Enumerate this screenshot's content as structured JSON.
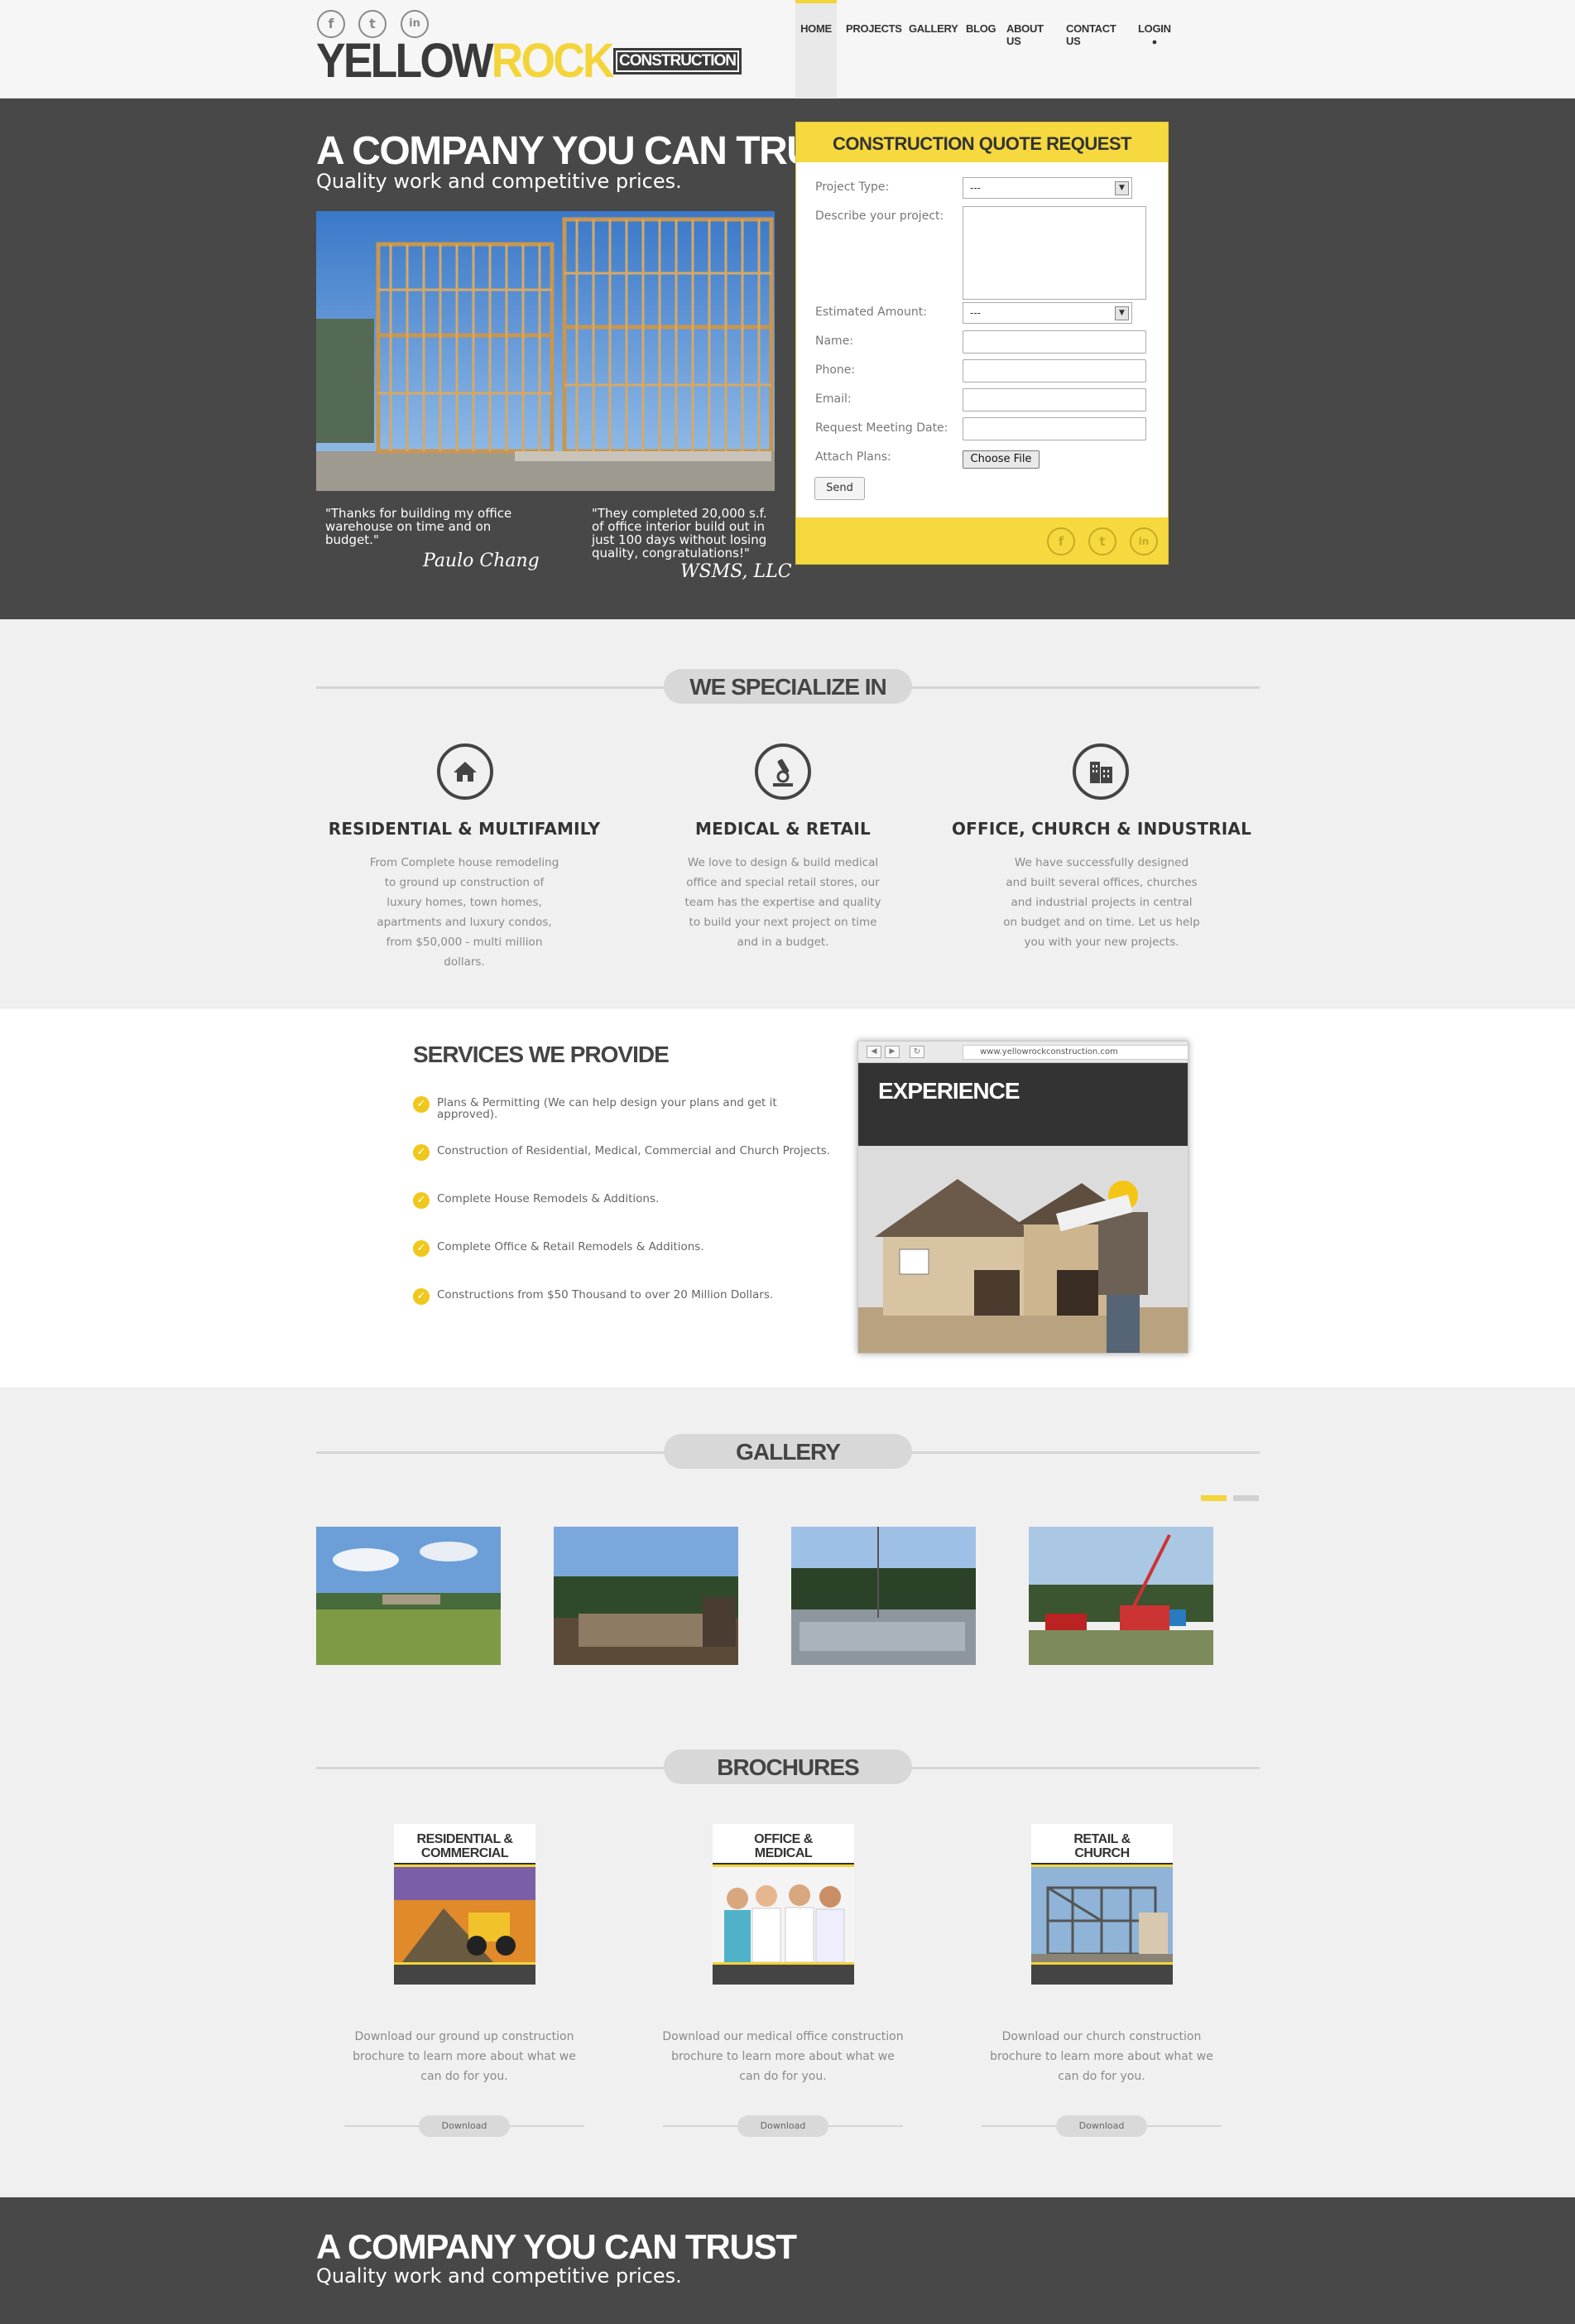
{
  "header": {
    "logo_part1": "YELLOW",
    "logo_part2": "ROCK",
    "logo_part3": "CONSTRUCTION",
    "social": [
      "f",
      "t",
      "in"
    ],
    "nav": [
      {
        "label": "HOME",
        "active": true
      },
      {
        "label": "PROJECTS"
      },
      {
        "label": "GALLERY"
      },
      {
        "label": "BLOG"
      },
      {
        "label": "ABOUT US"
      },
      {
        "label": "CONTACT US"
      },
      {
        "label": "LOGIN"
      }
    ]
  },
  "hero": {
    "title": "A COMPANY YOU CAN TRUST",
    "subtitle": "Quality work and competitive prices.",
    "quote1": "\"Thanks for building my office warehouse on time and on budget.\"",
    "quote1_author": "Paulo Chang",
    "quote2": "\"They completed 20,000 s.f. of office interior build out in just 100 days without losing quality, congratulations!\"",
    "quote2_author": "WSMS, LLC"
  },
  "quote_form": {
    "title": "CONSTRUCTION QUOTE REQUEST",
    "project_type_label": "Project Type:",
    "project_type_value": "---",
    "describe_label": "Describe your project:",
    "estimated_label": "Estimated Amount:",
    "estimated_value": "---",
    "name_label": "Name:",
    "phone_label": "Phone:",
    "email_label": "Email:",
    "meeting_label": "Request Meeting Date:",
    "attach_label": "Attach Plans:",
    "choose_file": "Choose File",
    "send": "Send"
  },
  "specialize": {
    "title": "WE SPECIALIZE IN",
    "items": [
      {
        "title": "RESIDENTIAL & MULTIFAMILY",
        "lines": [
          "From Complete house remodeling",
          "to ground up construction of",
          "luxury homes, town homes,",
          "apartments and luxury condos,",
          "from $50,000 - multi million",
          "dollars."
        ]
      },
      {
        "title": "MEDICAL & RETAIL",
        "lines": [
          "We love to design & build medical",
          "office and special retail stores, our",
          "team has the expertise and quality",
          "to build your next project on time",
          "and in a budget."
        ]
      },
      {
        "title": "OFFICE, CHURCH & INDUSTRIAL",
        "lines": [
          "We have successfully designed",
          "and built several offices, churches",
          "and industrial projects in central",
          "on budget and on time. Let us help",
          "you with your new projects."
        ]
      }
    ]
  },
  "services": {
    "title": "SERVICES WE PROVIDE",
    "items": [
      [
        "Plans & Permitting (We can help design your plans and get it",
        "approved)."
      ],
      [
        "Construction of Residential, Medical, Commercial and Church Projects."
      ],
      [
        "Complete House Remodels & Additions."
      ],
      [
        "Complete Office & Retail Remodels & Additions."
      ],
      [
        "Constructions from $50 Thousand to over 20 Million Dollars."
      ]
    ],
    "browser_url": "www.yellowrockconstruction.com",
    "experience_title": "EXPERIENCE"
  },
  "gallery": {
    "title": "GALLERY"
  },
  "brochures": {
    "title": "BROCHURES",
    "items": [
      {
        "label1": "RESIDENTIAL &",
        "label2": "COMMERCIAL",
        "lines": [
          "Download our ground up construction",
          "brochure to learn more about what we",
          "can do for you."
        ],
        "button": "Download"
      },
      {
        "label1": "OFFICE &",
        "label2": "MEDICAL",
        "lines": [
          "Download our medical office construction",
          "brochure to learn more about what we",
          "can do for you."
        ],
        "button": "Download"
      },
      {
        "label1": "RETAIL &",
        "label2": "CHURCH",
        "lines": [
          "Download our church construction",
          "brochure to learn more about what we",
          "can do for you."
        ],
        "button": "Download"
      }
    ]
  },
  "footer": {
    "title": "A COMPANY YOU CAN TRUST",
    "subtitle": "Quality work and competitive prices."
  },
  "colors": {
    "accent": "#f3d43a",
    "dark": "#484848"
  }
}
